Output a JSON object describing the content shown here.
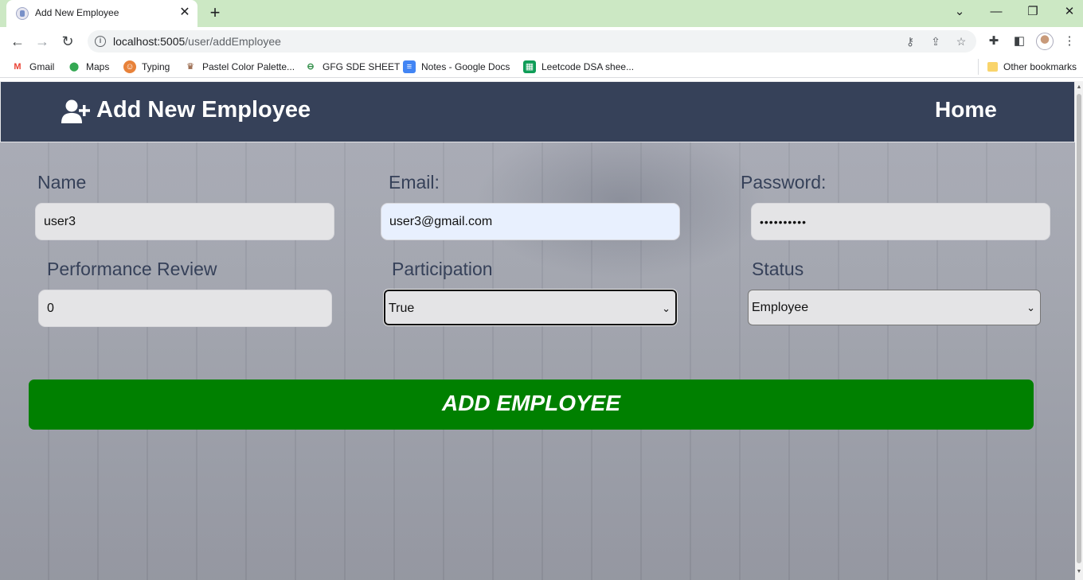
{
  "browser": {
    "tab_title": "Add New Employee",
    "url_host": "localhost:5005",
    "url_path": "/user/addEmployee",
    "bookmarks": [
      {
        "label": "Gmail",
        "icon": "gmail-icon"
      },
      {
        "label": "Maps",
        "icon": "maps-icon"
      },
      {
        "label": "Typing",
        "icon": "typing-icon"
      },
      {
        "label": "Pastel Color Palette...",
        "icon": "palette-icon"
      },
      {
        "label": "GFG SDE SHEET",
        "icon": "gfg-icon"
      },
      {
        "label": "Notes - Google Docs",
        "icon": "docs-icon"
      },
      {
        "label": "Leetcode DSA shee...",
        "icon": "sheets-icon"
      }
    ],
    "other_bookmarks": "Other bookmarks"
  },
  "navbar": {
    "brand": "Add New Employee",
    "home": "Home"
  },
  "form": {
    "name": {
      "label": "Name",
      "value": "user3"
    },
    "email": {
      "label": "Email:",
      "value": "user3@gmail.com"
    },
    "password": {
      "label": "Password:",
      "value": "••••••••••"
    },
    "performance": {
      "label": "Performance Review",
      "value": "0"
    },
    "participation": {
      "label": "Participation",
      "value": "True"
    },
    "status": {
      "label": "Status",
      "value": "Employee"
    },
    "submit": "ADD EMPLOYEE"
  },
  "colors": {
    "navbar": "#364159",
    "submit": "#008000",
    "tabstrip": "#cce8c4"
  }
}
